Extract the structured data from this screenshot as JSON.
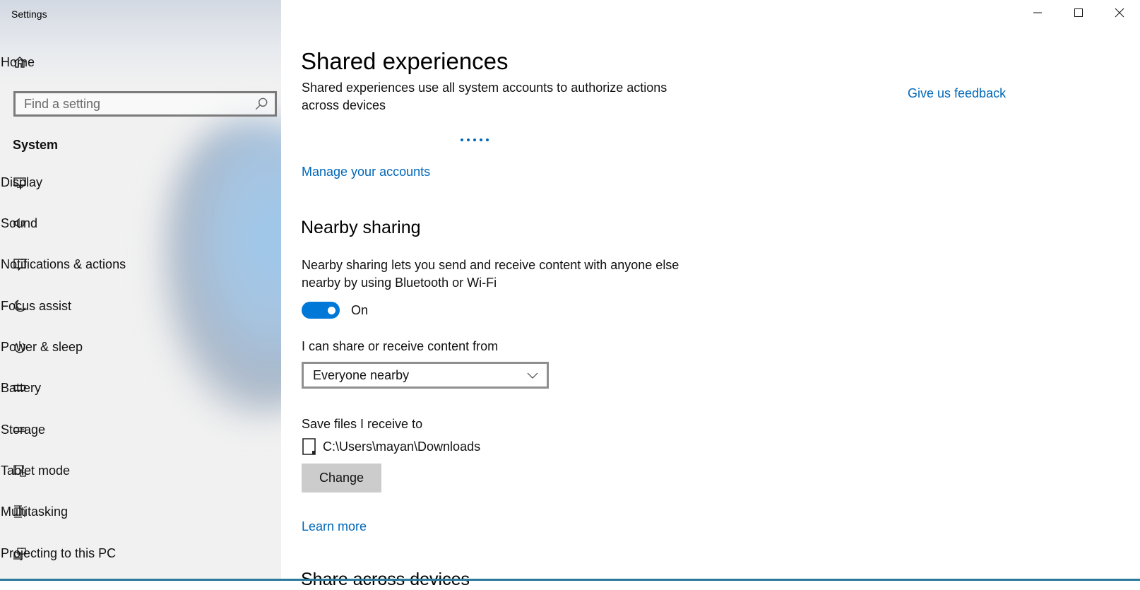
{
  "window": {
    "title": "Settings",
    "controls": {
      "minimize": "minimize-icon",
      "maximize": "maximize-icon",
      "close": "close-icon"
    }
  },
  "sidebar": {
    "home": {
      "label": "Home",
      "icon": "home-icon"
    },
    "search": {
      "placeholder": "Find a setting",
      "value": "",
      "icon": "search-icon"
    },
    "section": "System",
    "items": [
      {
        "label": "Display",
        "icon": "monitor-icon"
      },
      {
        "label": "Sound",
        "icon": "speaker-icon"
      },
      {
        "label": "Notifications & actions",
        "icon": "notification-icon"
      },
      {
        "label": "Focus assist",
        "icon": "moon-icon"
      },
      {
        "label": "Power & sleep",
        "icon": "power-icon"
      },
      {
        "label": "Battery",
        "icon": "battery-icon"
      },
      {
        "label": "Storage",
        "icon": "storage-icon"
      },
      {
        "label": "Tablet mode",
        "icon": "tablet-mode-icon"
      },
      {
        "label": "Multitasking",
        "icon": "multitasking-icon"
      },
      {
        "label": "Projecting to this PC",
        "icon": "projecting-icon"
      }
    ]
  },
  "main": {
    "title": "Shared experiences",
    "description": "Shared experiences use all system accounts to authorize actions across devices",
    "loading_indicator": "loading-dots",
    "manage_accounts_link": "Manage your accounts",
    "feedback_link": "Give us feedback",
    "nearby_sharing": {
      "heading": "Nearby sharing",
      "description": "Nearby sharing lets you send and receive content with anyone else nearby by using Bluetooth or Wi-Fi",
      "toggle_state": "On",
      "toggle_on": true,
      "share_from_label": "I can share or receive content from",
      "share_from_value": "Everyone nearby",
      "save_to_label": "Save files I receive to",
      "save_to_path": "C:\\Users\\mayan\\Downloads",
      "change_button": "Change",
      "learn_more_link": "Learn more"
    },
    "next_heading_partial": "Share across devices"
  },
  "colors": {
    "accent": "#0078d7",
    "link": "#0067b8",
    "button_bg": "#cccccc"
  }
}
